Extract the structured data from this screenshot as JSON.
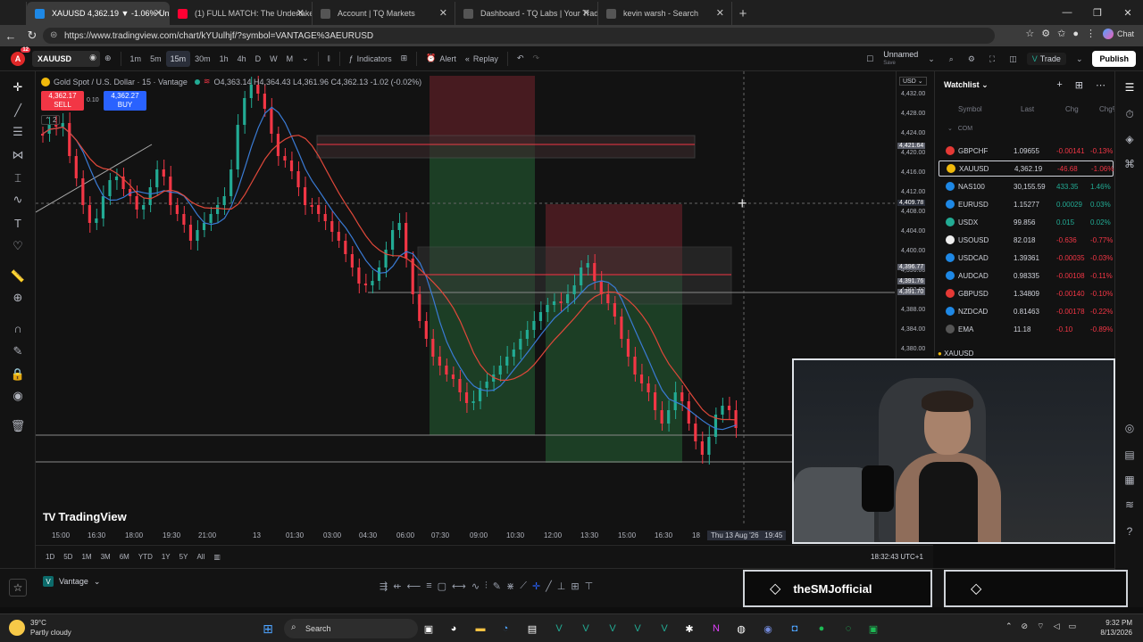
{
  "browser": {
    "tabs": [
      {
        "title": "XAUUSD 4,362.19 ▼ -1.06% Unna",
        "active": true,
        "icon_color": "#1e88e5"
      },
      {
        "title": "(1) FULL MATCH: The Undertaker",
        "active": false,
        "icon_color": "#ff0033"
      },
      {
        "title": "Account | TQ Markets",
        "active": false,
        "icon_color": "#555555"
      },
      {
        "title": "Dashboard - TQ Labs | Your Trade",
        "active": false,
        "icon_color": "#555555"
      },
      {
        "title": "kevin warsh - Search",
        "active": false,
        "icon_color": "#555555"
      }
    ],
    "new_tab": "+",
    "url": "https://www.tradingview.com/chart/kYUulhjf/?symbol=VANTAGE%3AEURUSD",
    "chat_label": "Chat"
  },
  "toolbar": {
    "symbol": "XAUUSD",
    "notif_count": "12",
    "avatar_letter": "A",
    "timeframes": [
      "1m",
      "5m",
      "15m",
      "30m",
      "1h",
      "4h",
      "D",
      "W",
      "M"
    ],
    "active_timeframe": "15m",
    "indicators_label": "Indicators",
    "alert_label": "Alert",
    "replay_label": "Replay",
    "layout_name": "Unnamed",
    "layout_state": "Save",
    "trade_label": "Trade",
    "publish_label": "Publish"
  },
  "legend": {
    "title": "Gold Spot / U.S. Dollar · 15 · Vantage",
    "ohlc": "O4,363.14 H4,364.43 L4,361.96 C4,362.13 -1.02 (-0.02%)",
    "sell_price": "4,362.17",
    "sell_label": "SELL",
    "buy_price": "4,362.27",
    "buy_label": "BUY",
    "spread": "0.10",
    "layer_count": "2"
  },
  "chart_logo": "TradingView",
  "x_axis_labels": [
    "15:00",
    "16:30",
    "18:00",
    "19:30",
    "21:00",
    "13",
    "01:30",
    "03:00",
    "04:30",
    "06:00",
    "07:30",
    "09:00",
    "10:30",
    "12:00",
    "13:30",
    "15:00",
    "16:30",
    "18"
  ],
  "x_axis_cursor": "Thu 13 Aug '26",
  "x_axis_cursor_time": "19:45",
  "price_axis": {
    "currency": "USD",
    "ticks": [
      "4,432.00",
      "4,428.00",
      "4,424.00",
      "4,420.00",
      "4,416.00",
      "4,412.00",
      "4,408.00",
      "4,404.00",
      "4,400.00",
      "4,396.00",
      "4,392.00",
      "4,388.00",
      "4,384.00",
      "4,380.00"
    ],
    "labels": [
      {
        "text": "4,421.64",
        "color": "#5d606b"
      },
      {
        "text": "4,409.78",
        "color": "#2a2e39"
      },
      {
        "text": "4,396.77",
        "color": "#5d606b"
      },
      {
        "text": "4,391.76",
        "color": "#5d606b"
      },
      {
        "text": "4,391.70",
        "color": "#5d606b"
      }
    ]
  },
  "range_buttons": [
    "1D",
    "5D",
    "1M",
    "3M",
    "6M",
    "YTD",
    "1Y",
    "5Y",
    "All"
  ],
  "clock": "18:32:43 UTC+1",
  "broker": "Vantage",
  "watchlist": {
    "title": "Watchlist",
    "columns": {
      "symbol": "Symbol",
      "last": "Last",
      "chg": "Chg",
      "chgp": "Chg%"
    },
    "category": "COM",
    "rows": [
      {
        "symbol": "GBPCHF",
        "last": "1.09655",
        "chg": "-0.00141",
        "pct": "-0.13%",
        "up": false,
        "icon": "#e53935"
      },
      {
        "symbol": "XAUUSD",
        "last": "4,362.19",
        "chg": "-46.68",
        "pct": "-1.06%",
        "up": false,
        "icon": "#f0b90b"
      },
      {
        "symbol": "NAS100",
        "last": "30,155.59",
        "chg": "433.35",
        "pct": "1.46%",
        "up": true,
        "icon": "#1e88e5"
      },
      {
        "symbol": "EURUSD",
        "last": "1.15277",
        "chg": "0.00029",
        "pct": "0.03%",
        "up": true,
        "icon": "#1e88e5"
      },
      {
        "symbol": "USDX",
        "last": "99.856",
        "chg": "0.015",
        "pct": "0.02%",
        "up": true,
        "icon": "#22ab94"
      },
      {
        "symbol": "USOUSD",
        "last": "82.018",
        "chg": "-0.636",
        "pct": "-0.77%",
        "up": false,
        "icon": "#eeeeee"
      },
      {
        "symbol": "USDCAD",
        "last": "1.39361",
        "chg": "-0.00035",
        "pct": "-0.03%",
        "up": false,
        "icon": "#1e88e5"
      },
      {
        "symbol": "AUDCAD",
        "last": "0.98335",
        "chg": "-0.00108",
        "pct": "-0.11%",
        "up": false,
        "icon": "#1e88e5"
      },
      {
        "symbol": "GBPUSD",
        "last": "1.34809",
        "chg": "-0.00140",
        "pct": "-0.10%",
        "up": false,
        "icon": "#e53935"
      },
      {
        "symbol": "NZDCAD",
        "last": "0.81463",
        "chg": "-0.00178",
        "pct": "-0.22%",
        "up": false,
        "icon": "#1e88e5"
      },
      {
        "symbol": "EMA",
        "last": "11.18",
        "chg": "-0.10",
        "pct": "-0.89%",
        "up": false,
        "icon": "#555555"
      }
    ],
    "footer_symbol": "XAUUSD"
  },
  "stream_brand": "theSMJofficial",
  "taskbar": {
    "temp": "39°C",
    "weather": "Partly cloudy",
    "search": "Search",
    "time": "9:32 PM",
    "date": "8/13/2026"
  }
}
